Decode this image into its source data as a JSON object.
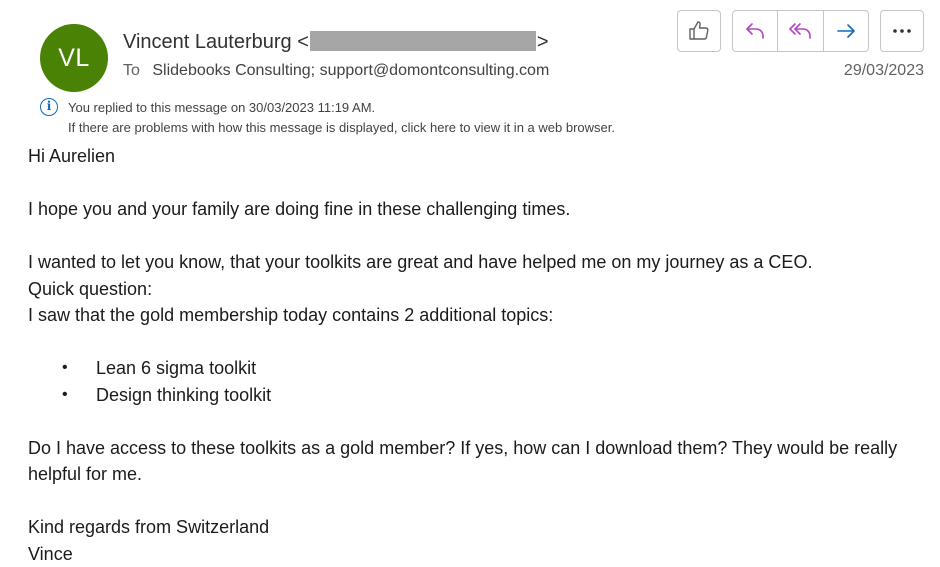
{
  "header": {
    "avatar_initials": "VL",
    "avatar_color": "#498205",
    "sender_name": "Vincent Lauterburg",
    "sender_open": "<",
    "sender_close": ">",
    "to_label": "To",
    "recipients": "Slidebooks Consulting; support@domontconsulting.com",
    "date": "29/03/2023"
  },
  "toolbar": {
    "like_icon": "thumbs-up-icon",
    "reply_icon": "reply-icon",
    "reply_all_icon": "reply-all-icon",
    "forward_icon": "forward-icon",
    "more_icon": "more-icon",
    "reply_color": "#b146c2",
    "forward_color": "#0f6cbd"
  },
  "info_bar": {
    "replied": "You replied to this message on 30/03/2023 11:19 AM.",
    "display_problem": "If there are problems with how this message is displayed, click here to view it in a web browser."
  },
  "body": {
    "greeting": "Hi Aurelien",
    "p1": "I hope you and your family are doing fine in these challenging times.",
    "p2": "I wanted to let you know, that your toolkits are great and have helped me on my journey as a CEO.",
    "p3": "Quick question:",
    "p4": "I saw that the gold membership today contains 2 additional topics:",
    "bullets": [
      "Lean 6 sigma toolkit",
      "Design thinking toolkit"
    ],
    "bullet_char": "•",
    "p5": "Do I have access to these toolkits as a gold member? If yes, how can I download them? They would be really helpful for me.",
    "closing": "Kind regards from Switzerland",
    "signature": "Vince"
  }
}
